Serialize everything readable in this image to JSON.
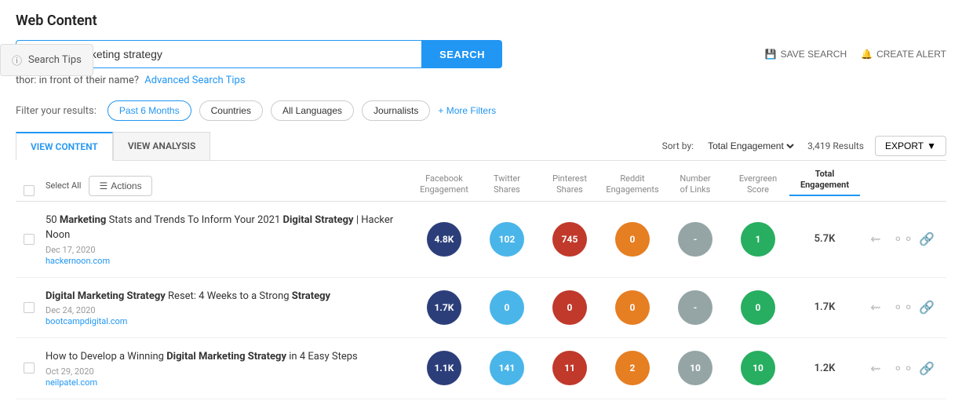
{
  "page": {
    "title": "Web Content"
  },
  "search": {
    "placeholder": "digital marketing strategy",
    "value": "digital marketing strategy",
    "button_label": "SEARCH",
    "tips_label": "Search Tips",
    "tip_text": "thor: in front of their name?",
    "tip_link": "Advanced Search Tips",
    "save_search_label": "SAVE SEARCH",
    "create_alert_label": "CREATE ALERT"
  },
  "filters": {
    "label": "Filter your results:",
    "items": [
      {
        "label": "Past 6 Months",
        "active": true
      },
      {
        "label": "Countries",
        "active": false
      },
      {
        "label": "All Languages",
        "active": false
      },
      {
        "label": "Journalists",
        "active": false
      }
    ],
    "more_label": "+ More Filters"
  },
  "tabs": [
    {
      "label": "VIEW CONTENT",
      "active": true
    },
    {
      "label": "VIEW ANALYSIS",
      "active": false
    }
  ],
  "sort": {
    "label": "Sort by:",
    "value": "Total Engagement",
    "results_count": "3,419 Results",
    "export_label": "EXPORT"
  },
  "table": {
    "select_all_label": "Select All",
    "actions_label": "Actions",
    "columns": [
      {
        "label": "Facebook\nEngagement",
        "active": false
      },
      {
        "label": "Twitter\nShares",
        "active": false
      },
      {
        "label": "Pinterest\nShares",
        "active": false
      },
      {
        "label": "Reddit\nEngagements",
        "active": false
      },
      {
        "label": "Number\nof Links",
        "active": false
      },
      {
        "label": "Evergreen\nScore",
        "active": false
      },
      {
        "label": "Total\nEngagement",
        "active": true
      }
    ],
    "rows": [
      {
        "title_parts": [
          {
            "text": "50 ",
            "bold": false
          },
          {
            "text": "Marketing",
            "bold": true
          },
          {
            "text": " Stats and Trends To Inform Your 2021 ",
            "bold": false
          },
          {
            "text": "Digital Strategy",
            "bold": true
          },
          {
            "text": " | Hacker Noon",
            "bold": false
          }
        ],
        "date": "Dec 17, 2020",
        "domain": "hackernoon.com",
        "facebook": "4.8K",
        "twitter": "102",
        "pinterest": "745",
        "reddit": "0",
        "links": "-",
        "evergreen": "1",
        "total": "5.7K"
      },
      {
        "title_parts": [
          {
            "text": "Digital Marketing Strategy",
            "bold": true
          },
          {
            "text": " Reset: 4 Weeks to a Strong ",
            "bold": false
          },
          {
            "text": "Strategy",
            "bold": true
          }
        ],
        "date": "Dec 24, 2020",
        "domain": "bootcampdigital.com",
        "facebook": "1.7K",
        "twitter": "0",
        "pinterest": "0",
        "reddit": "0",
        "links": "-",
        "evergreen": "0",
        "total": "1.7K"
      },
      {
        "title_parts": [
          {
            "text": "How to Develop a Winning ",
            "bold": false
          },
          {
            "text": "Digital Marketing Strategy",
            "bold": true
          },
          {
            "text": " in 4 Easy Steps",
            "bold": false
          }
        ],
        "date": "Oct 29, 2020",
        "domain": "neilpatel.com",
        "facebook": "1.1K",
        "twitter": "141",
        "pinterest": "11",
        "reddit": "2",
        "links": "10",
        "evergreen": "10",
        "total": "1.2K"
      }
    ]
  },
  "circle_colors": {
    "facebook": "#2c3e7a",
    "twitter": "#4ab5e8",
    "pinterest": "#c0392b",
    "reddit": "#e67e22",
    "links": "#95a5a6",
    "evergreen": "#27ae60"
  }
}
